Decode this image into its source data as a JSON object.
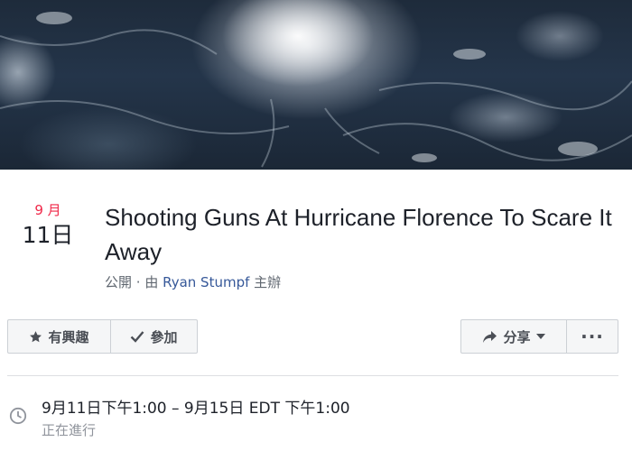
{
  "event": {
    "month": "9 月",
    "day": "11日",
    "title": "Shooting Guns At Hurricane Florence To Scare It Away",
    "privacy": "公開",
    "separator": " · ",
    "hosted_by_prefix": "由 ",
    "host": "Ryan Stumpf",
    "hosted_by_suffix": " 主辦"
  },
  "actions": {
    "interested_label": "有興趣",
    "join_label": "參加",
    "share_label": "分享",
    "more_label": "···"
  },
  "details": {
    "time": "9月11日下午1:00 – 9月15日 EDT 下午1:00",
    "status": "正在進行"
  },
  "icons": {
    "interested": "star-icon",
    "join": "checkmark-icon",
    "share": "share-arrow-icon",
    "share_dropdown": "caret-down-icon",
    "time": "clock-icon"
  },
  "colors": {
    "month": "#f02849",
    "link": "#365899",
    "text": "#1d2129",
    "muted": "#606770"
  }
}
